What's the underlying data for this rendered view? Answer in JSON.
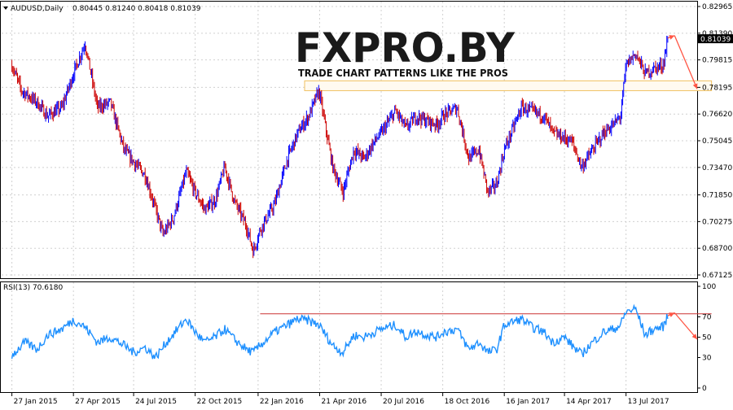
{
  "chart_data": {
    "type": "candlestick",
    "symbol_label": "AUDUSD,Daily",
    "ohlc_header": "0.80445 0.81240 0.80418 0.81039",
    "current_price": "0.81039",
    "price_ticks": [
      "0.82965",
      "0.81390",
      "0.79815",
      "0.78195",
      "0.76620",
      "0.75045",
      "0.73470",
      "0.71850",
      "0.70275",
      "0.68700",
      "0.67125"
    ],
    "ylim": [
      0.67125,
      0.82965
    ],
    "date_ticks": [
      "27 Jan 2015",
      "27 Apr 2015",
      "24 Jul 2015",
      "22 Oct 2015",
      "22 Jan 2016",
      "21 Apr 2016",
      "20 Jul 2016",
      "18 Oct 2016",
      "16 Jan 2017",
      "14 Apr 2017",
      "13 Jul 2017"
    ],
    "date_tick_values": [
      "2015-01-27",
      "2015-04-27",
      "2015-07-24",
      "2015-10-22",
      "2016-01-22",
      "2016-04-21",
      "2016-07-20",
      "2016-10-18",
      "2017-01-16",
      "2017-04-14",
      "2017-07-13"
    ],
    "price_path": [
      [
        "2015-01-27",
        0.795
      ],
      [
        "2015-02-10",
        0.78
      ],
      [
        "2015-03-05",
        0.773
      ],
      [
        "2015-03-20",
        0.765
      ],
      [
        "2015-04-10",
        0.77
      ],
      [
        "2015-04-27",
        0.79
      ],
      [
        "2015-05-14",
        0.808
      ],
      [
        "2015-06-01",
        0.77
      ],
      [
        "2015-06-20",
        0.773
      ],
      [
        "2015-07-10",
        0.745
      ],
      [
        "2015-07-24",
        0.738
      ],
      [
        "2015-08-10",
        0.73
      ],
      [
        "2015-08-25",
        0.71
      ],
      [
        "2015-09-05",
        0.695
      ],
      [
        "2015-09-20",
        0.705
      ],
      [
        "2015-10-09",
        0.732
      ],
      [
        "2015-10-22",
        0.72
      ],
      [
        "2015-11-05",
        0.71
      ],
      [
        "2015-11-20",
        0.715
      ],
      [
        "2015-12-04",
        0.735
      ],
      [
        "2015-12-18",
        0.715
      ],
      [
        "2016-01-05",
        0.7
      ],
      [
        "2016-01-15",
        0.685
      ],
      [
        "2016-01-25",
        0.698
      ],
      [
        "2016-02-15",
        0.713
      ],
      [
        "2016-03-05",
        0.74
      ],
      [
        "2016-03-20",
        0.755
      ],
      [
        "2016-04-05",
        0.765
      ],
      [
        "2016-04-20",
        0.78
      ],
      [
        "2016-05-10",
        0.735
      ],
      [
        "2016-05-25",
        0.72
      ],
      [
        "2016-06-10",
        0.745
      ],
      [
        "2016-06-25",
        0.74
      ],
      [
        "2016-07-10",
        0.75
      ],
      [
        "2016-07-20",
        0.755
      ],
      [
        "2016-08-10",
        0.768
      ],
      [
        "2016-08-25",
        0.758
      ],
      [
        "2016-09-10",
        0.765
      ],
      [
        "2016-09-25",
        0.762
      ],
      [
        "2016-10-10",
        0.76
      ],
      [
        "2016-10-18",
        0.765
      ],
      [
        "2016-11-08",
        0.77
      ],
      [
        "2016-11-25",
        0.74
      ],
      [
        "2016-12-10",
        0.745
      ],
      [
        "2016-12-23",
        0.72
      ],
      [
        "2017-01-05",
        0.725
      ],
      [
        "2017-01-16",
        0.745
      ],
      [
        "2017-02-10",
        0.77
      ],
      [
        "2017-02-25",
        0.768
      ],
      [
        "2017-03-15",
        0.765
      ],
      [
        "2017-03-28",
        0.755
      ],
      [
        "2017-04-14",
        0.752
      ],
      [
        "2017-04-25",
        0.75
      ],
      [
        "2017-05-09",
        0.735
      ],
      [
        "2017-05-25",
        0.745
      ],
      [
        "2017-06-10",
        0.755
      ],
      [
        "2017-06-25",
        0.76
      ],
      [
        "2017-07-05",
        0.765
      ],
      [
        "2017-07-13",
        0.795
      ],
      [
        "2017-07-27",
        0.802
      ],
      [
        "2017-08-10",
        0.79
      ],
      [
        "2017-08-22",
        0.793
      ],
      [
        "2017-09-05",
        0.795
      ],
      [
        "2017-09-12",
        0.8104
      ]
    ],
    "rsi": {
      "label": "RSI(13) 70.6180",
      "ticks": [
        "100",
        "70",
        "50",
        "30",
        "0"
      ],
      "ylim": [
        0,
        100
      ],
      "level_line": 73,
      "path": [
        [
          "2015-01-27",
          32
        ],
        [
          "2015-02-15",
          45
        ],
        [
          "2015-03-05",
          38
        ],
        [
          "2015-03-20",
          52
        ],
        [
          "2015-04-10",
          58
        ],
        [
          "2015-04-27",
          67
        ],
        [
          "2015-05-14",
          60
        ],
        [
          "2015-06-01",
          45
        ],
        [
          "2015-06-20",
          50
        ],
        [
          "2015-07-10",
          42
        ],
        [
          "2015-07-24",
          35
        ],
        [
          "2015-08-10",
          40
        ],
        [
          "2015-08-25",
          30
        ],
        [
          "2015-09-10",
          45
        ],
        [
          "2015-10-09",
          68
        ],
        [
          "2015-10-22",
          55
        ],
        [
          "2015-11-05",
          45
        ],
        [
          "2015-11-20",
          50
        ],
        [
          "2015-12-04",
          58
        ],
        [
          "2015-12-18",
          48
        ],
        [
          "2016-01-05",
          38
        ],
        [
          "2016-01-15",
          35
        ],
        [
          "2016-01-25",
          42
        ],
        [
          "2016-02-15",
          55
        ],
        [
          "2016-03-05",
          62
        ],
        [
          "2016-03-20",
          68
        ],
        [
          "2016-04-05",
          66
        ],
        [
          "2016-04-20",
          62
        ],
        [
          "2016-05-10",
          42
        ],
        [
          "2016-05-25",
          35
        ],
        [
          "2016-06-10",
          52
        ],
        [
          "2016-06-25",
          50
        ],
        [
          "2016-07-10",
          55
        ],
        [
          "2016-07-20",
          58
        ],
        [
          "2016-08-10",
          62
        ],
        [
          "2016-08-25",
          50
        ],
        [
          "2016-09-10",
          56
        ],
        [
          "2016-09-25",
          52
        ],
        [
          "2016-10-10",
          50
        ],
        [
          "2016-10-18",
          55
        ],
        [
          "2016-11-08",
          58
        ],
        [
          "2016-11-25",
          38
        ],
        [
          "2016-12-10",
          45
        ],
        [
          "2016-12-23",
          35
        ],
        [
          "2017-01-05",
          38
        ],
        [
          "2017-01-16",
          62
        ],
        [
          "2017-02-10",
          68
        ],
        [
          "2017-02-25",
          60
        ],
        [
          "2017-03-15",
          55
        ],
        [
          "2017-03-28",
          45
        ],
        [
          "2017-04-14",
          50
        ],
        [
          "2017-04-25",
          42
        ],
        [
          "2017-05-09",
          33
        ],
        [
          "2017-05-25",
          45
        ],
        [
          "2017-06-10",
          55
        ],
        [
          "2017-06-25",
          58
        ],
        [
          "2017-07-05",
          62
        ],
        [
          "2017-07-13",
          75
        ],
        [
          "2017-07-27",
          78
        ],
        [
          "2017-08-10",
          52
        ],
        [
          "2017-08-22",
          58
        ],
        [
          "2017-09-05",
          60
        ],
        [
          "2017-09-12",
          70.6
        ]
      ]
    },
    "annotations": {
      "resistance_zone": [
        0.78,
        0.7858
      ],
      "zone_dates": [
        "2016-03-30",
        "2017-11-15"
      ],
      "rsi_line_dates": [
        "2016-01-25",
        "2017-11-15"
      ],
      "arrow_dates": [
        "2017-09-12",
        "2017-09-22",
        "2017-10-25"
      ],
      "arrow_prices": [
        0.811,
        0.8125,
        0.781
      ],
      "rsi_arrow_values": [
        71,
        74,
        48
      ]
    },
    "colors": {
      "up": "#0000ff",
      "down": "#cc0000",
      "rsi": "#1e90ff",
      "zone_border": "#f0c060",
      "zone_fill": "#fffaf0",
      "level_line": "#cc3333",
      "arrow": "#ff5544",
      "grid": "#d0d0d0",
      "price_tag": "#000000"
    }
  },
  "watermark": {
    "brand": "FXPRO.BY",
    "tagline": "TRADE CHART PATTERNS LIKE THE PROS"
  }
}
